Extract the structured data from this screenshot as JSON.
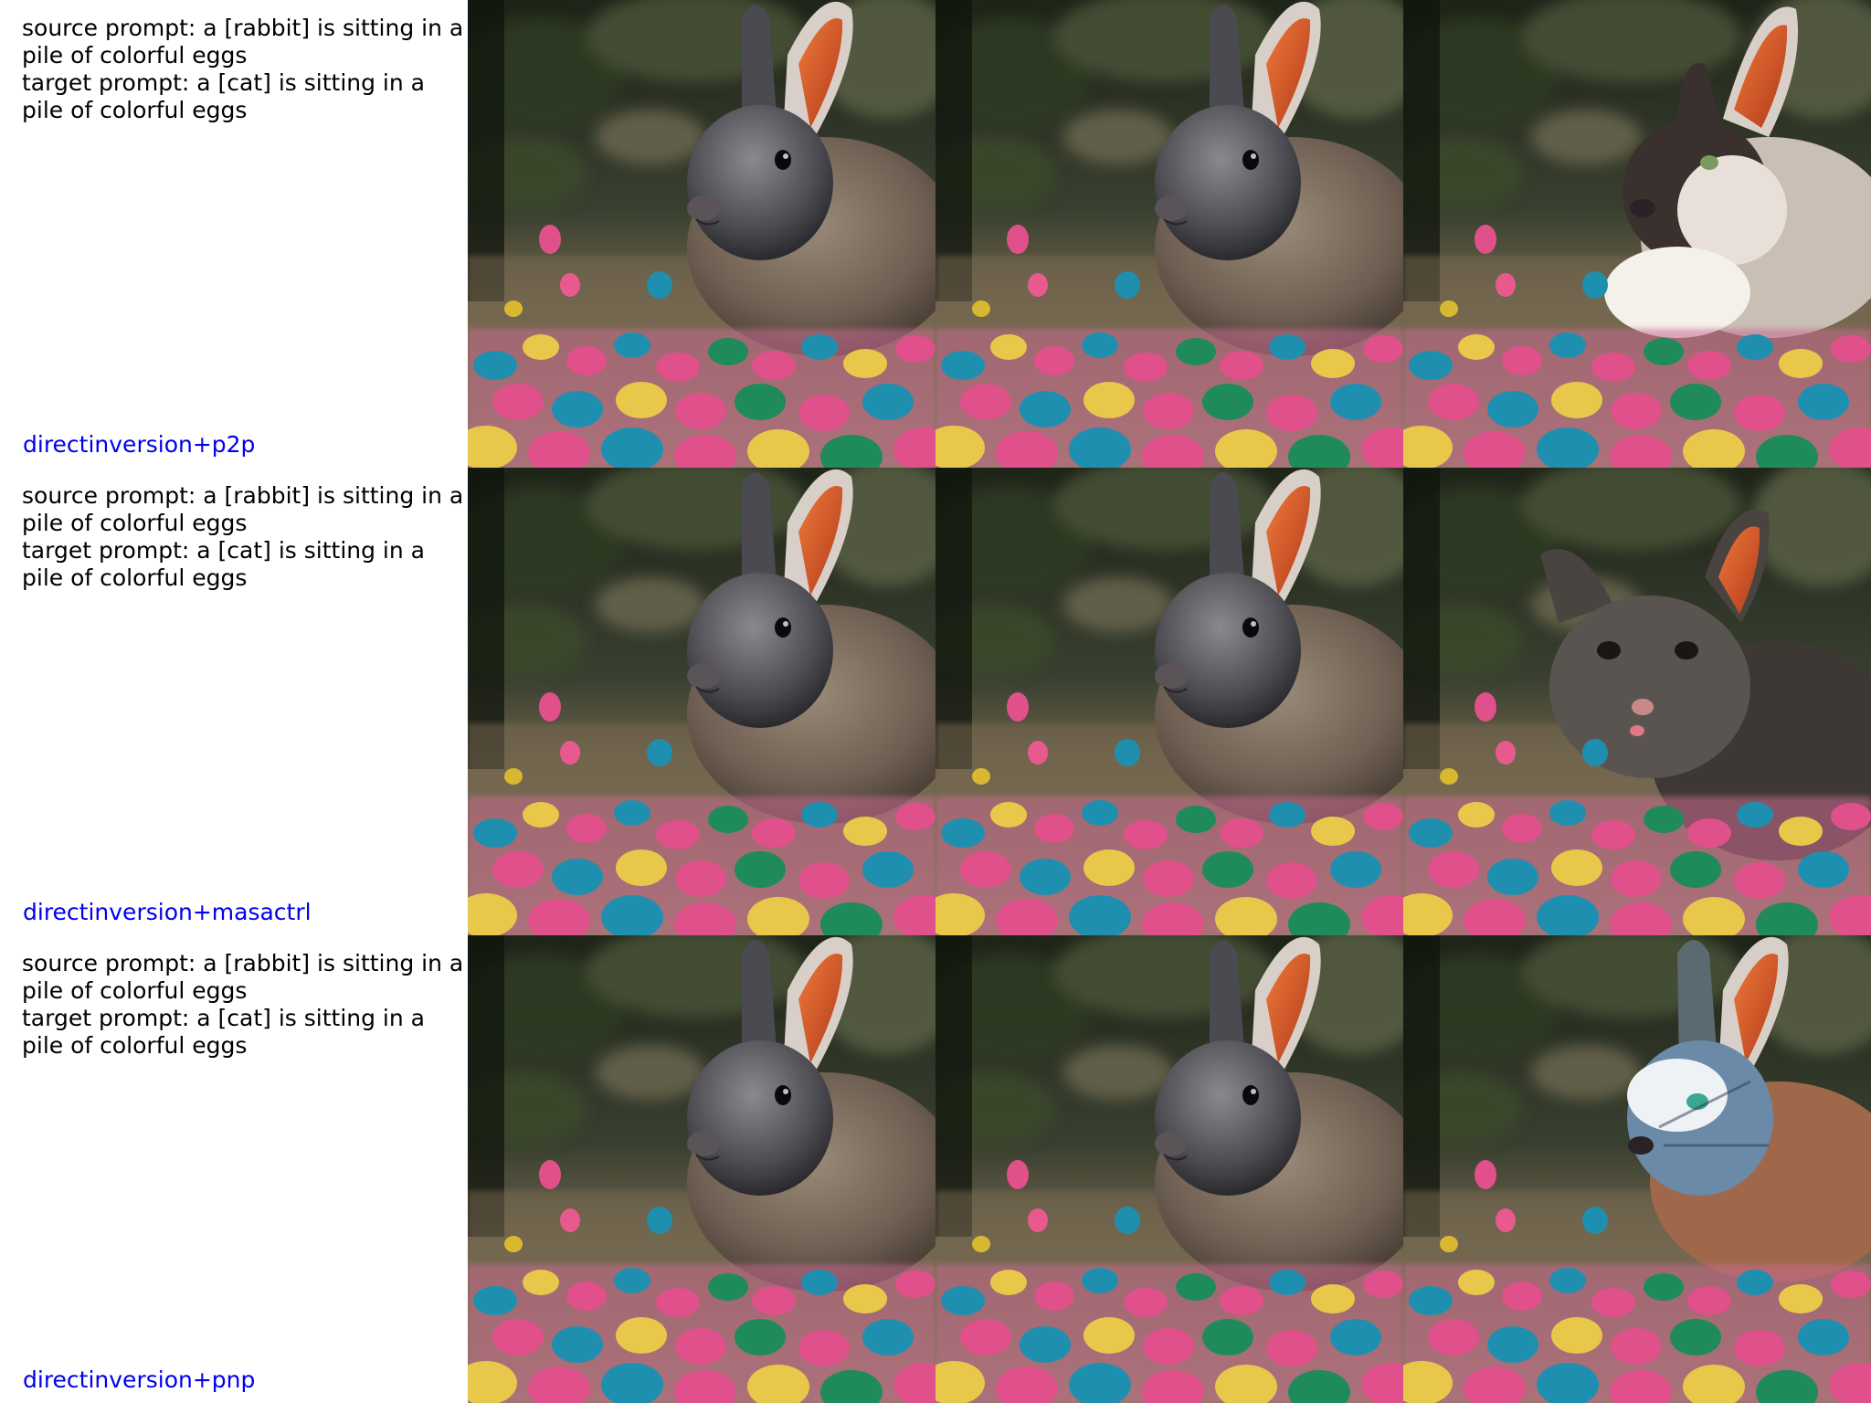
{
  "rows": [
    {
      "source_prompt": "source prompt: a [rabbit] is sitting in a pile of colorful eggs",
      "target_prompt": "target prompt: a [cat] is sitting in a pile of colorful eggs",
      "method": "directinversion+p2p",
      "images": [
        {
          "subject": "rabbit"
        },
        {
          "subject": "rabbit"
        },
        {
          "subject": "cat"
        }
      ]
    },
    {
      "source_prompt": "source prompt: a [rabbit] is sitting in a pile of colorful eggs",
      "target_prompt": "target prompt: a [cat] is sitting in a pile of colorful eggs",
      "method": "directinversion+masactrl",
      "images": [
        {
          "subject": "rabbit"
        },
        {
          "subject": "rabbit"
        },
        {
          "subject": "cat"
        }
      ]
    },
    {
      "source_prompt": "source prompt: a [rabbit] is sitting in a pile of colorful eggs",
      "target_prompt": "target prompt: a [cat] is sitting in a pile of colorful eggs",
      "method": "directinversion+pnp",
      "images": [
        {
          "subject": "rabbit"
        },
        {
          "subject": "rabbit"
        },
        {
          "subject": "cat"
        }
      ]
    }
  ],
  "colors": {
    "method_label": "#0000ee",
    "egg_pink": "#e0508a",
    "egg_teal": "#1f8fb0",
    "egg_yellow": "#e8c84a",
    "egg_green": "#1f8a5a",
    "foliage": "#2f3a26"
  }
}
